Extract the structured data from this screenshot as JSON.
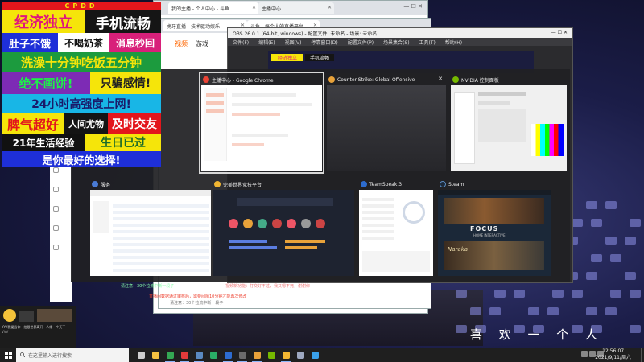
{
  "overlay": {
    "header": "CPDD",
    "rows": [
      [
        {
          "text": "经济独立",
          "bg": "#f5e50a",
          "fg": "#e0157c"
        },
        {
          "text": "手机流畅",
          "bg": "#151515",
          "fg": "#ffffff"
        }
      ],
      [
        {
          "text": "肚子不饿",
          "bg": "#1e2fd8",
          "fg": "#ffffff"
        },
        {
          "text": "不喝奶茶",
          "bg": "#ffffff",
          "fg": "#111111"
        },
        {
          "text": "消息秒回",
          "bg": "#d8207a",
          "fg": "#ffffff"
        }
      ],
      [
        {
          "text": "洗澡十分钟吃饭五分钟",
          "bg": "#1c9b3e",
          "fg": "#f5e50a"
        }
      ],
      [
        {
          "text": "绝不画饼!",
          "bg": "#7d2bb5",
          "fg": "#1df04a"
        },
        {
          "text": "只骗感情!",
          "bg": "#f5e50a",
          "fg": "#222222"
        }
      ],
      [
        {
          "text": "24小时高强度上网!",
          "bg": "#18b6e6",
          "fg": "#1a1a6a"
        }
      ],
      [
        {
          "text": "脾气超好",
          "bg": "#f5e50a",
          "fg": "#e3161c"
        },
        {
          "text": "人间尤物",
          "bg": "#141414",
          "fg": "#ffffff"
        },
        {
          "text": "及时交友",
          "bg": "#e3161c",
          "fg": "#ffffff"
        }
      ],
      [
        {
          "text": "21年生活经验",
          "bg": "#111111",
          "fg": "#ffffff"
        },
        {
          "text": "生日已过",
          "bg": "#f5e50a",
          "fg": "#1a6a2a"
        }
      ],
      [
        {
          "text": "是你最好的选择!",
          "bg": "#1e2fd8",
          "fg": "#ffffff"
        }
      ]
    ]
  },
  "browser": {
    "tabs": [
      "我的主播 - 个人中心 - 斗鱼",
      "主播中心",
      "斗鱼 - 每个人的直播平台",
      "虎牙直播 - 技术驱动娱乐"
    ],
    "nav": [
      "视频",
      "游戏"
    ],
    "notice": "请注意：30个拉流中断一段子",
    "notice2": "视频新功能：打交好不过，我又嗯不死，谢谢你",
    "hint": "直播间数据通过审核后，需要间隔10分钟才能再次修改",
    "link": "修改"
  },
  "obs": {
    "title": "OBS 26.0.1 (64-bit, windows) - 配置文件: 未命名 - 场景: 未命名",
    "menu": [
      "文件(F)",
      "编辑(E)",
      "视图(V)",
      "停靠窗口(D)",
      "配置文件(P)",
      "场景集合(S)",
      "工具(T)",
      "帮助(H)"
    ]
  },
  "switcher": {
    "tiles": [
      {
        "label": "主播中心 - Google Chrome",
        "icon": "#ea4335",
        "selected": true
      },
      {
        "label": "Counter-Strike: Global Offensive",
        "icon": "#e8a23a",
        "selected": false,
        "close": "✕"
      },
      {
        "label": "NVIDIA 控制面板",
        "icon": "#76b900",
        "selected": false
      },
      {
        "label": "服务",
        "icon": "#4a7bd6",
        "selected": false
      },
      {
        "label": "完美世界竞技平台",
        "icon": "#f2b632",
        "selected": false
      },
      {
        "label": "TeamSpeak 3",
        "icon": "#2d6ccf",
        "selected": false
      },
      {
        "label": "Steam",
        "icon": "#1b2838",
        "selected": false
      }
    ],
    "steam": {
      "headline": "FOCUS",
      "sub": "HOME INTERACTIVE",
      "game": "Naraka"
    }
  },
  "desktop": {
    "lyric": "喜 欢 一 个 人",
    "cam_caption": "YYY我爱当你 - 拍跟世界离开 - 人缘一个天下",
    "cam_tag": "VVV"
  },
  "taskbar": {
    "search_placeholder": "在这里输入进行搜索",
    "time": "12:56:07",
    "date": "2021/9/11/周六",
    "apps": [
      {
        "icon": "task-view-icon",
        "color": "#cfcfcf",
        "open": false
      },
      {
        "icon": "file-explorer-icon",
        "color": "#f5c242",
        "open": false
      },
      {
        "icon": "chrome-icon",
        "color": "#34a853",
        "open": true
      },
      {
        "icon": "netease-music-icon",
        "color": "#e33b3b",
        "open": true
      },
      {
        "icon": "steam-icon",
        "color": "#5a8ac0",
        "open": true
      },
      {
        "icon": "wechat-icon",
        "color": "#2aae67",
        "open": false
      },
      {
        "icon": "teamspeak-icon",
        "color": "#2d6ccf",
        "open": true
      },
      {
        "icon": "obs-icon",
        "color": "#6c6c6c",
        "open": true
      },
      {
        "icon": "csgo-icon",
        "color": "#e8a23a",
        "open": true
      },
      {
        "icon": "nvidia-icon",
        "color": "#76b900",
        "open": false
      },
      {
        "icon": "perfect-world-icon",
        "color": "#f2b632",
        "open": true
      },
      {
        "icon": "services-icon",
        "color": "#9ea9c0",
        "open": false
      },
      {
        "icon": "qq-icon",
        "color": "#3aa0ea",
        "open": false
      }
    ]
  }
}
